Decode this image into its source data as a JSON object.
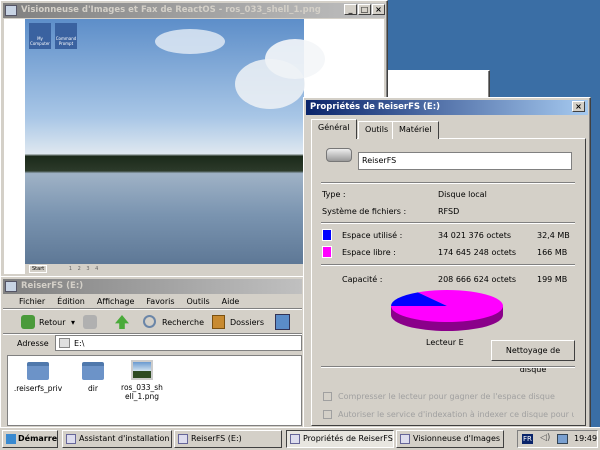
{
  "viewer": {
    "title": "Visionneuse d'Images et Fax de ReactOS - ros_033_shell_1.png",
    "desktop_icons": [
      "My Computer",
      "Command Prompt"
    ],
    "start": "Start",
    "pages": [
      "1",
      "2",
      "3",
      "4"
    ]
  },
  "explorer": {
    "title": "ReiserFS (E:)",
    "menu": [
      "Fichier",
      "Édition",
      "Affichage",
      "Favoris",
      "Outils",
      "Aide"
    ],
    "toolbar": {
      "back": "Retour",
      "search": "Recherche",
      "folders": "Dossiers"
    },
    "address_label": "Adresse",
    "address": "E:\\",
    "files": [
      {
        "name": ".reiserfs_priv",
        "icon": "folder-icon"
      },
      {
        "name": "dir",
        "icon": "folder-icon"
      },
      {
        "name": "ros_033_shell_1.png",
        "icon": "image-file-icon"
      }
    ]
  },
  "props": {
    "title": "Propriétés de ReiserFS (E:)",
    "tabs": [
      "Général",
      "Outils",
      "Matériel"
    ],
    "name": "ReiserFS",
    "type_label": "Type :",
    "type": "Disque local",
    "fs_label": "Système de fichiers :",
    "fs": "RFSD",
    "used_label": "Espace utilisé :",
    "used_bytes": "34 021 376 octets",
    "used_h": "32,4 MB",
    "free_label": "Espace libre :",
    "free_bytes": "174 645 248 octets",
    "free_h": "166 MB",
    "cap_label": "Capacité :",
    "cap_bytes": "208 666 624 octets",
    "cap_h": "199 MB",
    "drive": "Lecteur E",
    "cleanup": "Nettoyage de disque",
    "compress": "Compresser le lecteur pour gagner de l'espace disque",
    "index": "Autoriser le service d'indexation à indexer ce disque pour une recl",
    "used_color": "#0000ff",
    "free_color": "#ff00ff",
    "used_fraction": 0.163
  },
  "taskbar": {
    "start": "Démarrer",
    "items": [
      "Assistant d'installation ...",
      "ReiserFS (E:)",
      "Propriétés de ReiserFS...",
      "Visionneuse d'Images ..."
    ],
    "lang": "FR",
    "clock": "19:49"
  }
}
